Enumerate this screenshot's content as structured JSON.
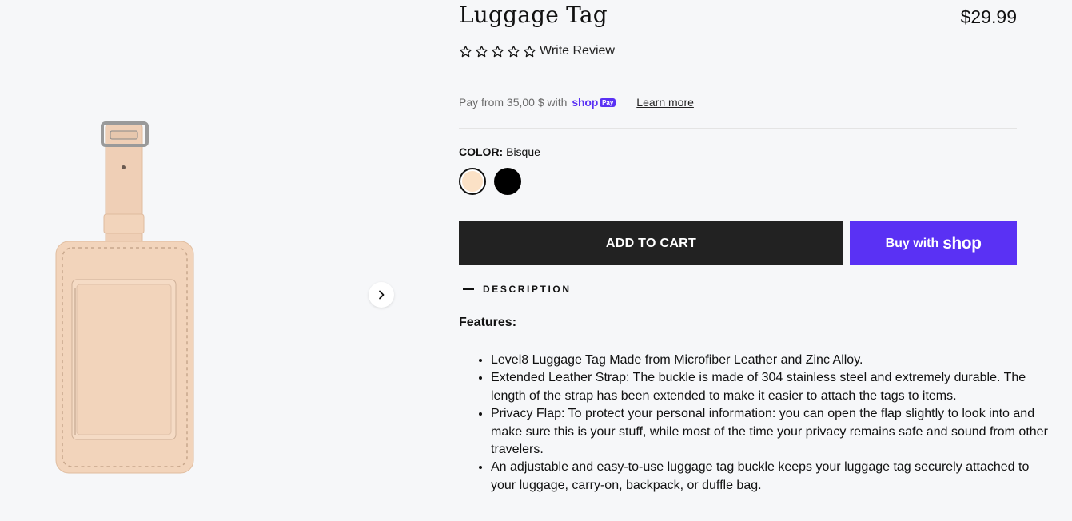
{
  "product": {
    "title": "Luggage Tag",
    "price": "$29.99",
    "rating_stars": 0,
    "write_review_label": "Write Review"
  },
  "shop_pay": {
    "text": "Pay from 35,00 $ with",
    "brand": "shop",
    "badge": "Pay",
    "learn_more": "Learn more"
  },
  "color": {
    "label": "COLOR:",
    "selected": "Bisque",
    "options": [
      {
        "name": "Bisque",
        "hex": "#fbe1c6"
      },
      {
        "name": "Black",
        "hex": "#000000"
      }
    ]
  },
  "buttons": {
    "add_to_cart": "ADD TO CART",
    "buy_with": "Buy with",
    "buy_brand": "shop"
  },
  "description": {
    "heading": "DESCRIPTION",
    "features_title": "Features:",
    "items": [
      "Level8 Luggage Tag Made from Microfiber Leather and Zinc Alloy.",
      "Extended Leather Strap: The buckle is made of 304 stainless steel and extremely durable. The length of the strap has been extended to make it easier to attach the tags to items.",
      "Privacy Flap: To protect your personal information: you can open the flap slightly to look into and make sure this is your stuff, while most of the time your privacy remains safe and sound from other travelers.",
      "An adjustable and easy-to-use luggage tag buckle keeps your luggage tag securely attached to your luggage, carry-on, backpack, or duffle bag."
    ]
  },
  "colors": {
    "accent_shop": "#5a31f4",
    "cart_button": "#222222",
    "product_leather": "#f2d4bb"
  },
  "icons": {
    "next": "chevron-right-icon",
    "star": "star-outline-icon"
  }
}
